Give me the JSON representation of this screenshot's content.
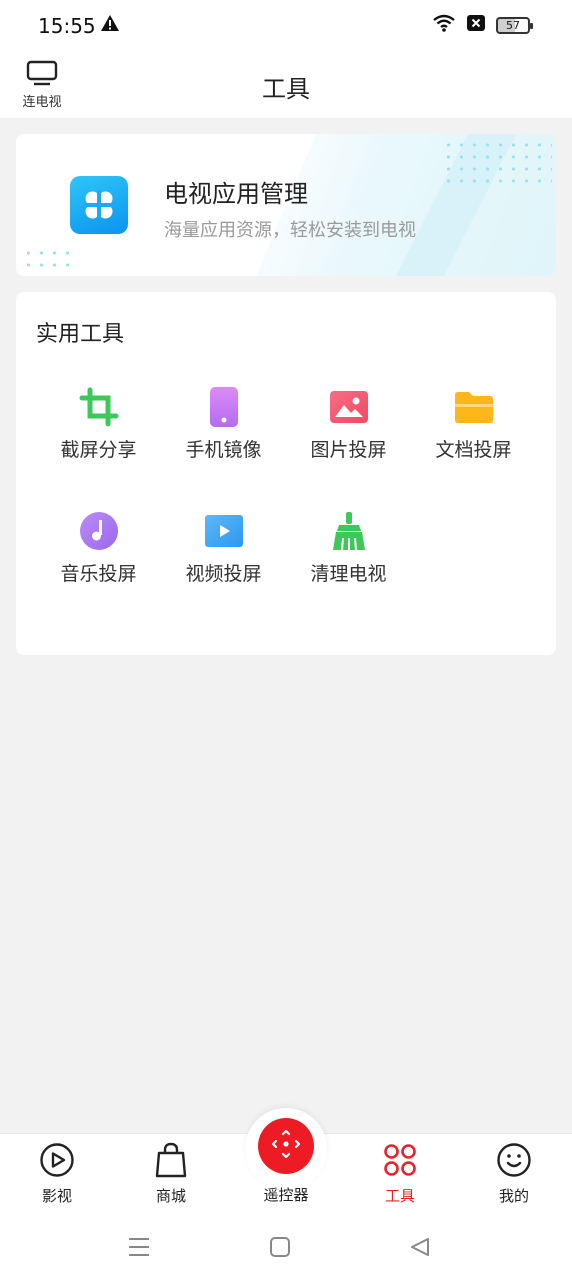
{
  "status_bar": {
    "time": "15:55",
    "battery": "57"
  },
  "header": {
    "connect_label": "连电视",
    "title": "工具"
  },
  "promo": {
    "title": "电视应用管理",
    "subtitle": "海量应用资源，轻松安装到电视"
  },
  "tools": {
    "section_title": "实用工具",
    "items": [
      {
        "label": "截屏分享",
        "icon": "crop-icon",
        "color": "#3cc85a"
      },
      {
        "label": "手机镜像",
        "icon": "phone-icon",
        "color": "#c77df2"
      },
      {
        "label": "图片投屏",
        "icon": "image-icon",
        "color": "#f25c74"
      },
      {
        "label": "文档投屏",
        "icon": "folder-icon",
        "color": "#ffb618"
      },
      {
        "label": "音乐投屏",
        "icon": "music-icon",
        "color": "#a478f0"
      },
      {
        "label": "视频投屏",
        "icon": "video-icon",
        "color": "#3aa8f5"
      },
      {
        "label": "清理电视",
        "icon": "broom-icon",
        "color": "#3cc85a"
      }
    ]
  },
  "bottom_nav": {
    "items": [
      {
        "label": "影视",
        "icon": "play-circle-icon"
      },
      {
        "label": "商城",
        "icon": "shopping-bag-icon"
      },
      {
        "label": "遥控器",
        "icon": "remote-icon"
      },
      {
        "label": "工具",
        "icon": "tools-grid-icon",
        "active": true
      },
      {
        "label": "我的",
        "icon": "smiley-icon"
      }
    ],
    "accent": "#e5232c"
  }
}
